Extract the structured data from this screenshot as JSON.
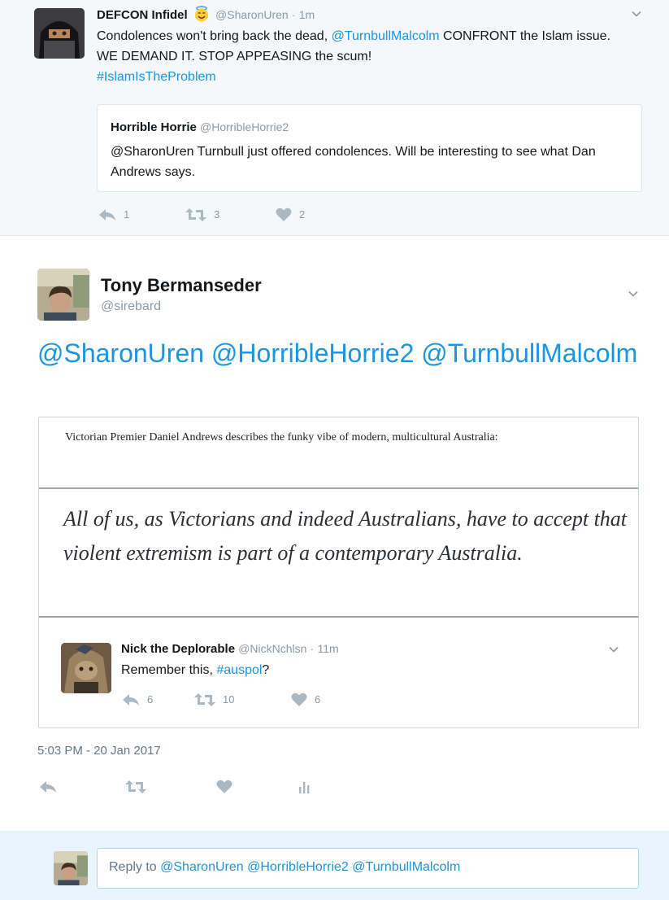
{
  "parent_tweet": {
    "name": "DEFCON Infidel",
    "handle": "@SharonUren",
    "separator": "·",
    "time": "1m",
    "text_parts": {
      "pre": "Condolences won't bring back the dead, ",
      "mention": "@TurnbullMalcolm",
      "post": " CONFRONT the Islam issue. WE DEMAND IT. STOP APPEASING the scum!",
      "hashtag": "#IslamIsTheProblem"
    },
    "quoted": {
      "name": "Horrible Horrie",
      "handle": "@HorribleHorrie2",
      "text": "@SharonUren  Turnbull just offered condolences. Will be interesting to see what Dan Andrews says."
    },
    "reply_count": "1",
    "retweet_count": "3",
    "like_count": "2"
  },
  "main_tweet": {
    "name": "Tony Bermanseder",
    "handle": "@sirebard",
    "text": "@SharonUren @HorribleHorrie2 @TurnbullMalcolm",
    "media": {
      "caption": "Victorian Premier Daniel Andrews describes the funky vibe of modern, multicultural Australia:",
      "quote": "All of us, as Victorians and indeed Australians, have to accept that violent extremism is part of a contemporary Australia.",
      "embedded": {
        "name": "Nick the Deplorable",
        "handle": "@NickNchlsn",
        "separator": "·",
        "time": "11m",
        "text_pre": "Remember this, ",
        "hashtag": "#auspol",
        "text_post": "?",
        "reply_count": "6",
        "retweet_count": "10",
        "like_count": "6"
      }
    },
    "timestamp": "5:03 PM - 20 Jan 2017"
  },
  "reply": {
    "placeholder_prefix": "Reply to ",
    "mentions": "@SharonUren @HorribleHorrie2 @TurnbullMalcolm"
  },
  "icons": {
    "reply": "reply-icon",
    "retweet": "retweet-icon",
    "like": "heart-icon",
    "analytics": "analytics-icon",
    "more": "chevron-down-icon",
    "emoji": "halo-smile-emoji-icon"
  },
  "colors": {
    "link": "#1b95e0",
    "muted": "#8a9ba8",
    "parent_bg": "#f5f8fa",
    "reply_bg": "#e8f5fd"
  }
}
